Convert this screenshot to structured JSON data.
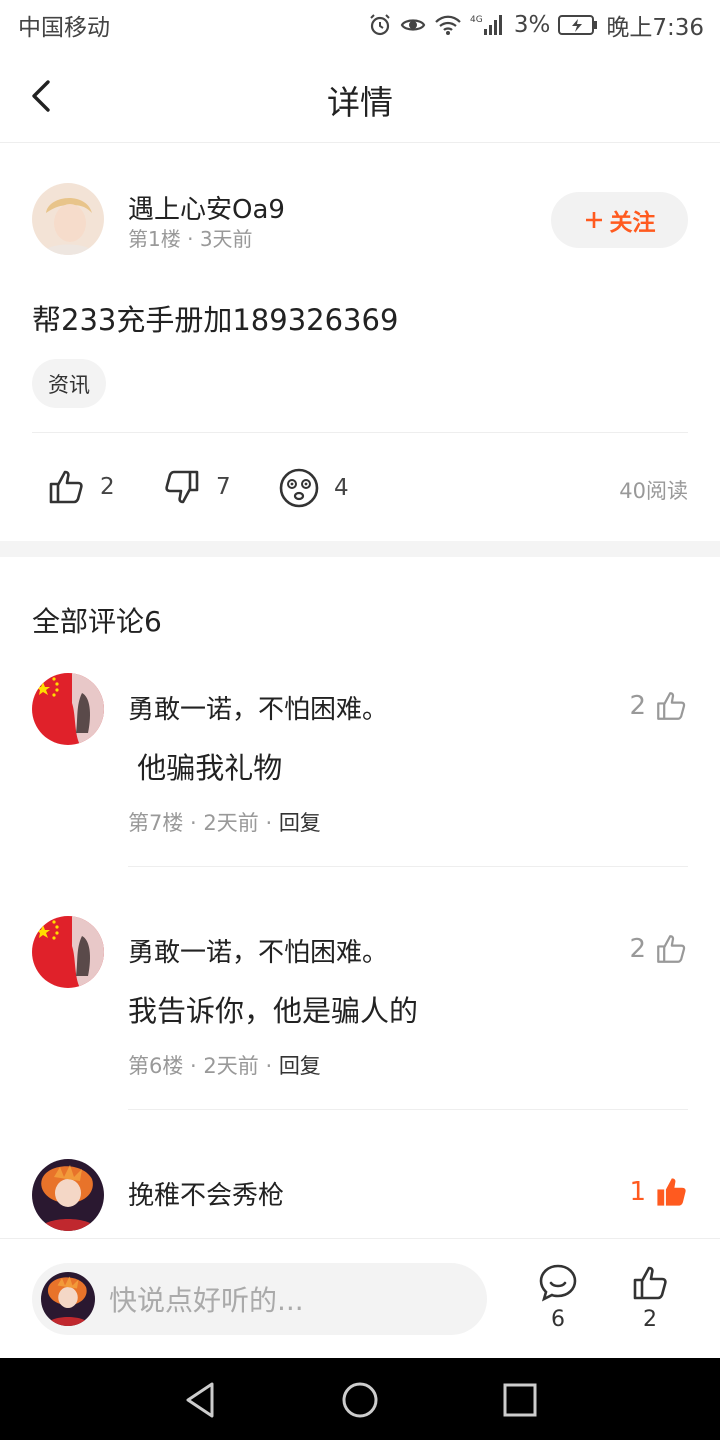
{
  "status_bar": {
    "carrier": "中国移动",
    "network": "4G",
    "battery": "3%",
    "time": "晚上7:36"
  },
  "header": {
    "title": "详情",
    "back_icon": "chevron-left-icon"
  },
  "post": {
    "author": "遇上心安Oa9",
    "floor": "第1楼",
    "time": "3天前",
    "follow_label": "关注",
    "content": "帮233充手册加189326369",
    "tag": "资讯",
    "likes": "2",
    "dislikes": "7",
    "wow": "4",
    "reads": "40阅读"
  },
  "comments": {
    "title": "全部评论6",
    "reply_label": "回复",
    "items": [
      {
        "name": "勇敢一诺，不怕困难。",
        "text": " 他骗我礼物",
        "floor": "第7楼",
        "time": "2天前",
        "likes": "2",
        "liked": false
      },
      {
        "name": "勇敢一诺，不怕困难。",
        "text": "我告诉你，他是骗人的",
        "floor": "第6楼",
        "time": "2天前",
        "likes": "2",
        "liked": false
      },
      {
        "name": "挽稚不会秀枪",
        "text": "",
        "floor": "",
        "time": "",
        "likes": "1",
        "liked": true
      }
    ]
  },
  "bottom_bar": {
    "placeholder": "快说点好听的...",
    "comment_count": "6",
    "like_count": "2"
  },
  "colors": {
    "accent": "#ff5a1f",
    "muted": "#999999",
    "divider": "#eeeeee"
  }
}
